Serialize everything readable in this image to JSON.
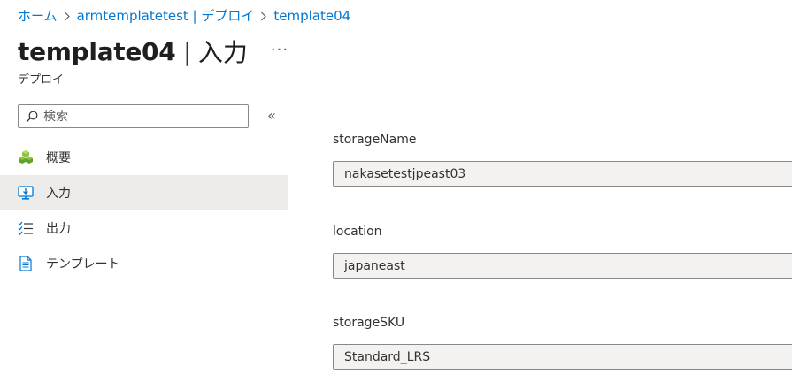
{
  "breadcrumb": {
    "items": [
      {
        "label": "ホーム"
      },
      {
        "label": "armtemplatetest | デプロイ"
      },
      {
        "label": "template04"
      }
    ]
  },
  "header": {
    "title": "template04",
    "separator": "|",
    "subtitle_section": "入力",
    "more_label": "···",
    "resource_type": "デプロイ"
  },
  "search": {
    "placeholder": "検索",
    "collapse_label": "«"
  },
  "nav": {
    "items": [
      {
        "label": "概要",
        "icon": "overview-cubes-icon",
        "active": false
      },
      {
        "label": "入力",
        "icon": "input-monitor-icon",
        "active": true
      },
      {
        "label": "出力",
        "icon": "output-list-icon",
        "active": false
      },
      {
        "label": "テンプレート",
        "icon": "template-document-icon",
        "active": false
      }
    ]
  },
  "fields": [
    {
      "label": "storageName",
      "value": "nakasetestjpeast03"
    },
    {
      "label": "location",
      "value": "japaneast"
    },
    {
      "label": "storageSKU",
      "value": "Standard_LRS"
    }
  ],
  "colors": {
    "link": "#0078d4",
    "active_nav_bg": "#edebe9",
    "field_bg": "#f3f2f1",
    "text": "#323130"
  }
}
